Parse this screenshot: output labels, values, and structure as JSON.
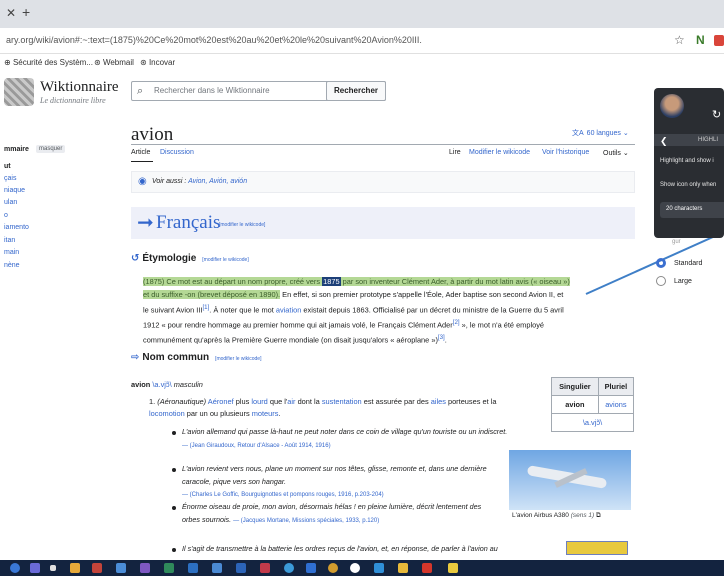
{
  "browser": {
    "url": "ary.org/wiki/avion#:~:text=(1875)%20Ce%20mot%20est%20au%20et%20le%20suivant%20Avion%20III.",
    "bookmarks": [
      "Sécurité des Systèm...",
      "Webmail",
      "Incovar"
    ]
  },
  "site": {
    "name": "Wiktionnaire",
    "tagline": "Le dictionnaire libre"
  },
  "search": {
    "placeholder": "Rechercher dans le Wiktionnaire",
    "button": "Rechercher"
  },
  "sidebar": {
    "title": "mmaire",
    "hide": "masquer",
    "items": [
      "ut",
      "çais",
      "niaque",
      "ulan",
      "o",
      "iamento",
      "itan",
      "main",
      "nène"
    ]
  },
  "page": {
    "title": "avion",
    "languages": "60 langues",
    "tabs_left": [
      "Article",
      "Discussion"
    ],
    "tabs_right": [
      "Lire",
      "Modifier le wikicode",
      "Voir l'historique",
      "Outils"
    ],
    "see_also_label": "Voir aussi :",
    "see_also_links": "Avion, Avión, avión"
  },
  "francais": {
    "title": "Français",
    "edit": "[modifier le wikicode]"
  },
  "etymologie": {
    "title": "Étymologie",
    "edit": "[modifier le wikicode]",
    "p1_hl1": "(1875) Ce mot est au départ un nom propre, créé vers ",
    "p1_year": "1875",
    "p1_hl2": " par son inventeur Clément Ader, à partir du mot latin avis (« oiseau »)",
    "p1_hl3": "et du suffixe -on (brevet déposé en 1890).",
    "p1_rest1": " En effet, si son premier prototype s'appelle l'Éole, Ader baptise son second Avion II, et",
    "p1_line3": "le suivant Avion III",
    "p1_ref1": "[1]",
    "p1_line3b": ". À noter que le mot ",
    "p1_aviation": "aviation",
    "p1_line3c": " existait depuis 1863. Officialisé par un décret du ministre de la Guerre du 5 avril",
    "p1_line4": "1912 « pour rendre hommage au premier homme qui ait jamais volé, le Français Clément Ader",
    "p1_ref2": "[2]",
    "p1_line4b": " », le mot n'a été employé",
    "p1_line5": "communément qu'après la Première Guerre mondiale (on disait jusqu'alors « aéroplane »)",
    "p1_ref3": "[3]",
    "p1_line5b": "."
  },
  "nom_commun": {
    "title": "Nom commun",
    "edit": "[modifier le wikicode]",
    "headword": "avion",
    "ipa": "\\a.vjɔ̃\\",
    "gender": "masculin",
    "def_num": "1.",
    "def_domain": "(Aéronautique)",
    "def_text_a": "Aéronef",
    "def_text_b": " plus ",
    "def_text_c": "lourd",
    "def_text_d": " que l'",
    "def_text_e": "air",
    "def_text_f": " dont la ",
    "def_text_g": "sustentation",
    "def_text_h": " est assurée par des ",
    "def_text_i": "ailes",
    "def_text_j": " porteuses et la",
    "def_text_k": "locomotion",
    "def_text_l": " par un ou plusieurs ",
    "def_text_m": "moteurs",
    "def_text_n": ".",
    "quote1": "L'avion allemand qui passe là-haut ne peut noter dans ce coin de village qu'un touriste ou un indiscret.",
    "quote1_src": "— (Jean Giraudoux, Retour d'Alsace - Août 1914, 1916)",
    "quote2": "L'avion revient vers nous, plane un moment sur nos têtes, glisse, remonte et, dans une dernière caracole, pique vers son hangar.",
    "quote2_src": "— (Charles Le Goffic, Bourguignottes et pompons rouges, 1916, p.203-204)",
    "quote3": "Énorme oiseau de proie, mon avion, désormais hélas ! en pleine lumière, décrit lentement des orbes sournois.",
    "quote3_src": "— (Jacques Mortane, Missions spéciales, 1933, p.120)",
    "quote4": "Il s'agit de transmettre à la batterie les ordres reçus de l'avion, et, en réponse, de parler à l'avion au"
  },
  "inflection": {
    "h1": "Singulier",
    "h2": "Pluriel",
    "sg": "avion",
    "pl": "avions",
    "ipa": "\\a.vjɔ̃\\"
  },
  "image": {
    "caption": "L'avion Airbus A380",
    "caption_note": "(sens 1)"
  },
  "overlay": {
    "highlight": "HIGHLI",
    "line1": "Highlight and show i",
    "line2": "Show icon only when",
    "chip": "20 characters",
    "faint": "gur",
    "options": [
      "Standard",
      "Large"
    ],
    "accent": "#3b6fd0"
  },
  "colors": {
    "link": "#3366cc",
    "highlight": "#b4d895",
    "selection": "#1c3f78",
    "taskbar": "#13233f"
  }
}
